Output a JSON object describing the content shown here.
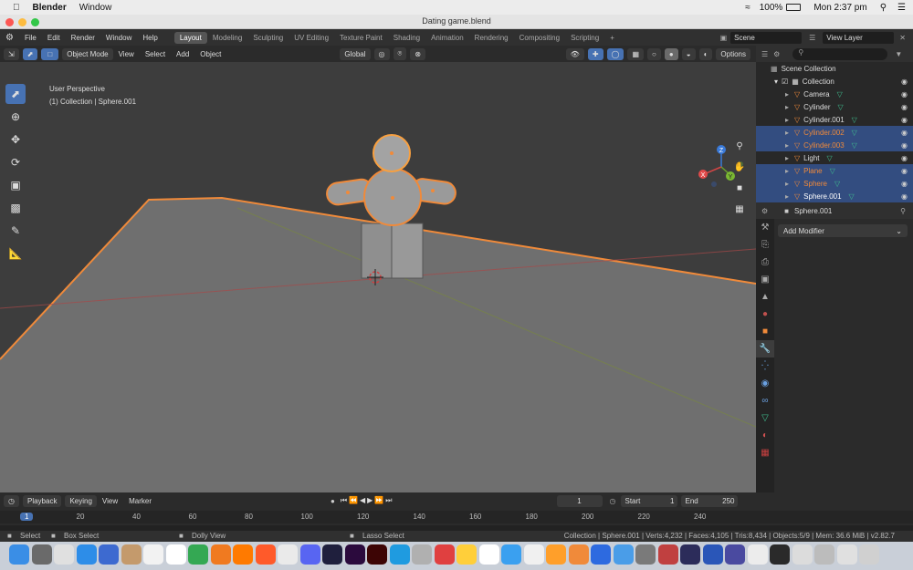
{
  "mac_menubar": {
    "app_name": "Blender",
    "menu_window": "Window",
    "battery": "100%",
    "clock": "Mon 2:37 pm"
  },
  "window_title": "Dating game.blend",
  "topbar": {
    "menus": [
      "File",
      "Edit",
      "Render",
      "Window",
      "Help"
    ],
    "workspaces": [
      "Layout",
      "Modeling",
      "Sculpting",
      "UV Editing",
      "Texture Paint",
      "Shading",
      "Animation",
      "Rendering",
      "Compositing",
      "Scripting"
    ],
    "active_workspace": "Layout",
    "add_tab": "+",
    "scene_label": "Scene",
    "view_layer_label": "View Layer"
  },
  "viewport_header": {
    "mode": "Object Mode",
    "menus": [
      "View",
      "Select",
      "Add",
      "Object"
    ],
    "transform": "Global",
    "options": "Options"
  },
  "viewport": {
    "perspective": "User Perspective",
    "collection_info": "(1) Collection | Sphere.001",
    "gizmo": {
      "z": "Z",
      "y": "Y",
      "x": "X"
    }
  },
  "outliner": {
    "root": "Scene Collection",
    "collection": "Collection",
    "items": [
      {
        "name": "Camera",
        "selected": false,
        "color": "#dddddd"
      },
      {
        "name": "Cylinder",
        "selected": false,
        "color": "#dddddd"
      },
      {
        "name": "Cylinder.001",
        "selected": false,
        "color": "#dddddd"
      },
      {
        "name": "Cylinder.002",
        "selected": true,
        "color": "#f08a3a"
      },
      {
        "name": "Cylinder.003",
        "selected": true,
        "color": "#f08a3a"
      },
      {
        "name": "Light",
        "selected": false,
        "color": "#dddddd"
      },
      {
        "name": "Plane",
        "selected": true,
        "color": "#f08a3a"
      },
      {
        "name": "Sphere",
        "selected": true,
        "color": "#f08a3a"
      },
      {
        "name": "Sphere.001",
        "selected": true,
        "color": "#ffffff"
      }
    ]
  },
  "properties": {
    "object_name": "Sphere.001",
    "add_modifier": "Add Modifier"
  },
  "timeline": {
    "menus": [
      "Playback",
      "Keying",
      "View",
      "Marker"
    ],
    "current_frame": "1",
    "start_label": "Start",
    "start": "1",
    "end_label": "End",
    "end": "250",
    "ruler": [
      "1",
      "20",
      "40",
      "60",
      "80",
      "100",
      "120",
      "140",
      "160",
      "180",
      "200",
      "220",
      "240"
    ]
  },
  "statusbar": {
    "select": "Select",
    "box_select": "Box Select",
    "dolly_view": "Dolly View",
    "lasso_select": "Lasso Select",
    "stats": "Collection | Sphere.001 | Verts:4,232 | Faces:4,105 | Tris:8,434 | Objects:5/9 | Mem: 36.6 MiB | v2.82.7"
  },
  "colors": {
    "accent": "#4772b3",
    "selection_orange": "#f08a3a",
    "bg_viewport": "#3d3d3d"
  }
}
